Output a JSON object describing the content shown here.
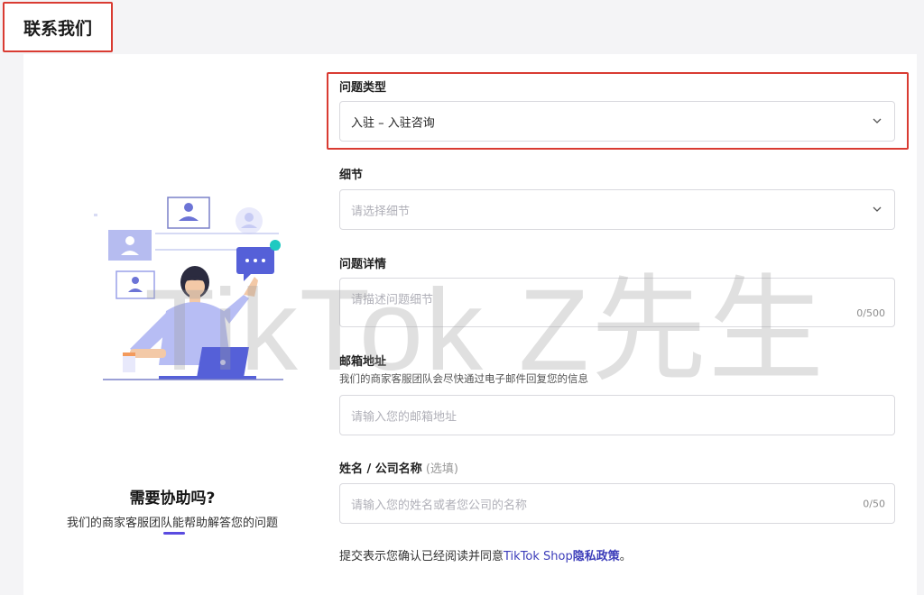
{
  "header": {
    "title": "联系我们"
  },
  "left_panel": {
    "help_title": "需要协助吗?",
    "help_desc": "我们的商家客服团队能帮助解答您的问题"
  },
  "form": {
    "issue_type": {
      "label": "问题类型",
      "value": "入驻 – 入驻咨询"
    },
    "detail": {
      "label": "细节",
      "placeholder": "请选择细节"
    },
    "issue_detail": {
      "label": "问题详情",
      "placeholder": "请描述问题细节",
      "counter": "0/500"
    },
    "email": {
      "label": "邮箱地址",
      "hint": "我们的商家客服团队会尽快通过电子邮件回复您的信息",
      "placeholder": "请输入您的邮箱地址"
    },
    "name": {
      "label": "姓名 / 公司名称",
      "optional": "(选填)",
      "placeholder": "请输入您的姓名或者您公司的名称",
      "counter": "0/50"
    },
    "consent": {
      "prefix": "提交表示您确认已经阅读并同意",
      "shop": "TikTok Shop",
      "policy": "隐私政策",
      "suffix": "。"
    }
  },
  "watermark": {
    "text": "TikTok Z先生"
  },
  "colors": {
    "accent": "#5a4be0",
    "highlight_border": "#d93b32",
    "link": "#3c3dba"
  },
  "icons": {
    "dropdown": "chevron-down-icon"
  }
}
